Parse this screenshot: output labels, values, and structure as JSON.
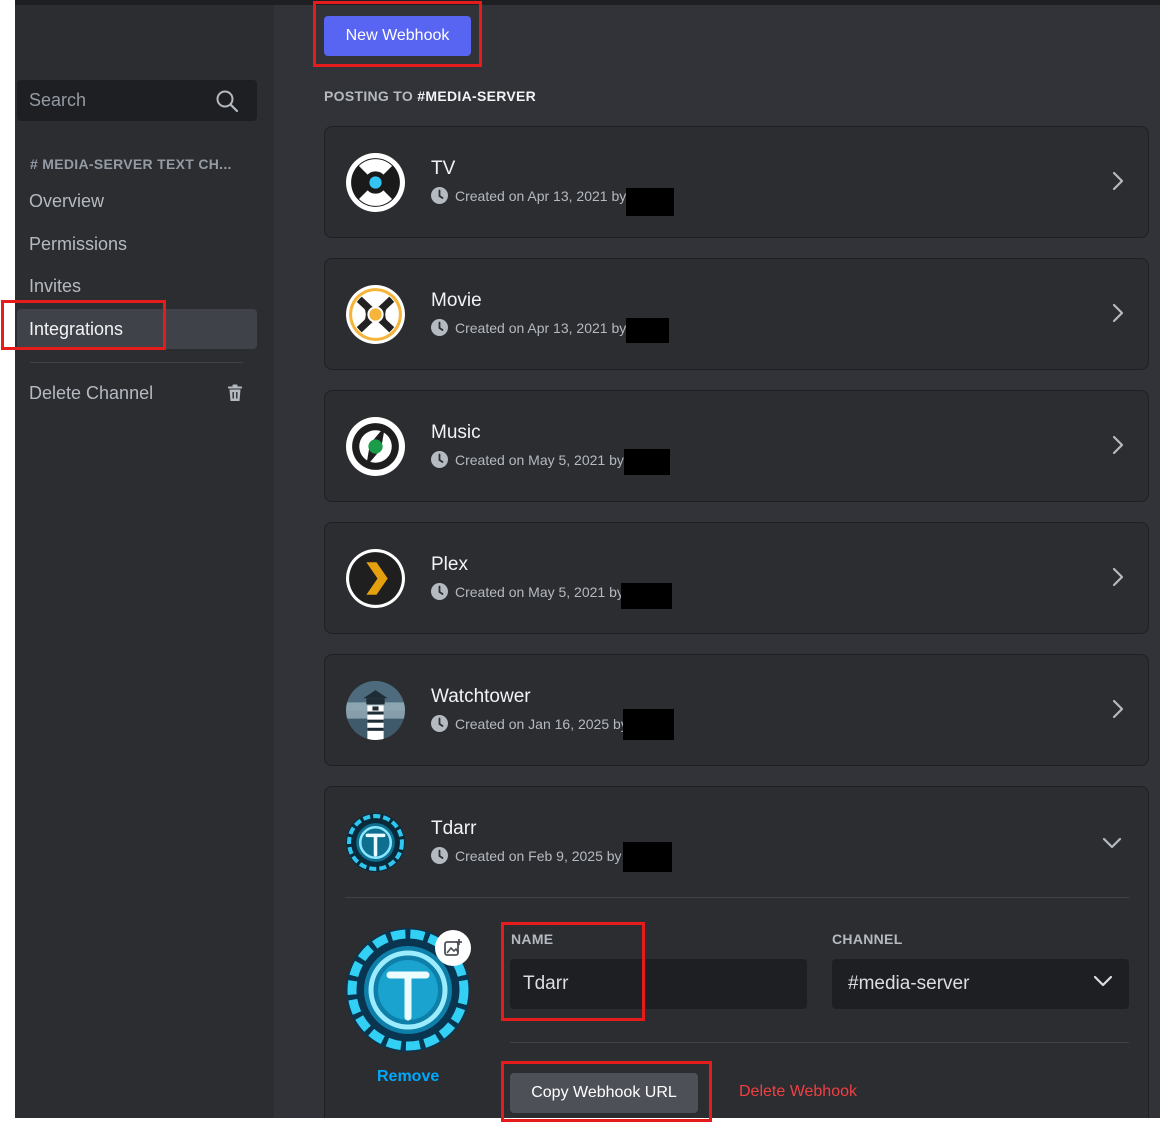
{
  "sidebar": {
    "search_placeholder": "Search",
    "category": "# MEDIA-SERVER TEXT CH...",
    "items": [
      {
        "label": "Overview"
      },
      {
        "label": "Permissions"
      },
      {
        "label": "Invites"
      },
      {
        "label": "Integrations",
        "selected": true
      }
    ],
    "delete_channel": "Delete Channel"
  },
  "main": {
    "new_webhook": "New Webhook",
    "posting_prefix": "POSTING TO ",
    "posting_channel": "#MEDIA-SERVER",
    "webhooks": [
      {
        "name": "TV",
        "created": "Created on Apr 13, 2021 by",
        "icon": "sonarr-icon"
      },
      {
        "name": "Movie",
        "created": "Created on Apr 13, 2021 by",
        "icon": "radarr-icon"
      },
      {
        "name": "Music",
        "created": "Created on May 5, 2021 by",
        "icon": "lidarr-icon"
      },
      {
        "name": "Plex",
        "created": "Created on May 5, 2021 by",
        "icon": "plex-icon"
      },
      {
        "name": "Watchtower",
        "created": "Created on Jan 16, 2025 by",
        "icon": "watchtower-icon"
      },
      {
        "name": "Tdarr",
        "created": "Created on Feb 9, 2025 by",
        "icon": "tdarr-icon"
      }
    ],
    "expanded": {
      "name_label": "NAME",
      "name_value": "Tdarr",
      "channel_label": "CHANNEL",
      "channel_value": "#media-server",
      "remove": "Remove",
      "copy_url": "Copy Webhook URL",
      "delete": "Delete Webhook"
    }
  },
  "colors": {
    "background": "#313338",
    "sidebar": "#2b2d31",
    "accent": "#5865f2",
    "link": "#00a8fc",
    "danger": "#f23f42",
    "highlight": "#e61c1c"
  }
}
